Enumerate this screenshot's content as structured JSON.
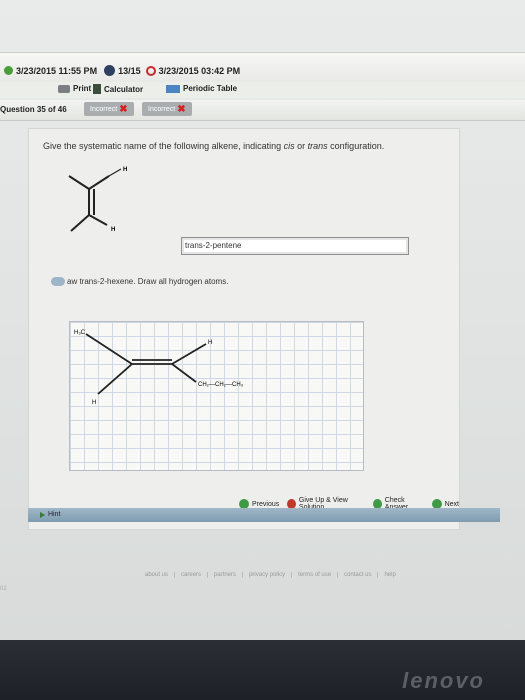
{
  "header": {
    "due_date": "3/23/2015 11:55 PM",
    "score": "13/15",
    "submitted": "3/23/2015 03:42 PM"
  },
  "toolbar": {
    "print_label": "Print",
    "calculator_label": "Calculator",
    "periodic_label": "Periodic Table"
  },
  "question_bar": {
    "question_number": "Question 35 of 46",
    "attempt1": "Incorrect",
    "attempt2": "Incorrect"
  },
  "question": {
    "text_prefix": "Give the systematic name of the following alkene, indicating ",
    "cis": "cis",
    "or": " or ",
    "trans": "trans",
    "text_suffix": " configuration.",
    "h_top": "H",
    "h_bottom": "H",
    "answer_value": "trans-2-pentene",
    "draw_instruction": "aw trans-2-hexene. Draw all hydrogen atoms."
  },
  "drawing": {
    "h3c": "H₃C",
    "h_top": "H",
    "chain": "CH₂—CH₂—CH₃",
    "h_bottom": "H"
  },
  "actions": {
    "previous": "Previous",
    "give_up": "Give Up & View Solution",
    "check": "Check Answer",
    "next": "Next"
  },
  "hint": {
    "label": "Hint"
  },
  "footer": {
    "links": [
      "about us",
      "careers",
      "partners",
      "privacy policy",
      "terms of use",
      "contact us",
      "help"
    ]
  },
  "left_mark": "02",
  "brand": "lenovo"
}
